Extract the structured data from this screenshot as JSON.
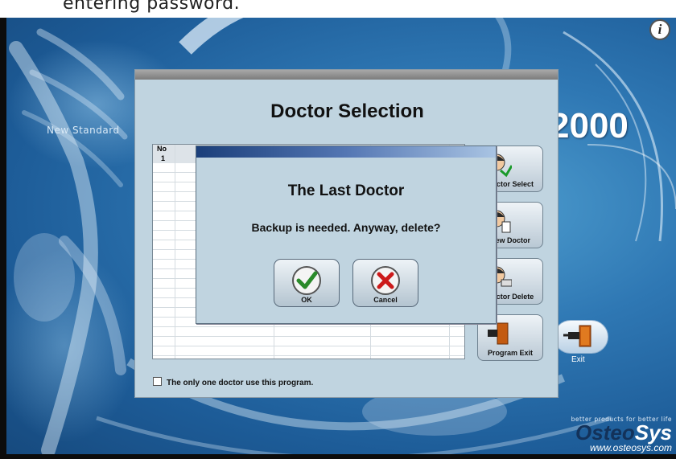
{
  "top_banner": {
    "text": "entering password."
  },
  "background": {
    "tagline": "New Standard",
    "product_number": "2000",
    "exit_label": "Exit",
    "logo": {
      "tagline": "better products for better life",
      "name_part1": "Osteo",
      "name_part2": "Sys",
      "url": "www.osteosys.com"
    }
  },
  "doctor_dialog": {
    "title": "Doctor Selection",
    "table": {
      "header": "No",
      "rows": [
        "1"
      ]
    },
    "side_buttons": [
      "Doctor Select",
      "New Doctor",
      "Doctor Delete",
      "Program Exit"
    ],
    "checkbox_label": "The only one doctor use this program."
  },
  "confirm_dialog": {
    "title": "The Last Doctor",
    "message": "Backup is needed. Anyway, delete?",
    "ok_label": "OK",
    "cancel_label": "Cancel"
  }
}
